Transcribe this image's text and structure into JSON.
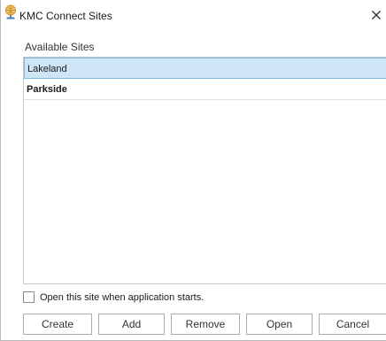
{
  "window": {
    "title": "KMC Connect Sites",
    "close_glyph": "✕"
  },
  "list": {
    "label": "Available Sites",
    "selected_index": 0,
    "items": [
      {
        "label": "Lakeland",
        "bold": false
      },
      {
        "label": "Parkside",
        "bold": true
      }
    ]
  },
  "startup_option": {
    "label": "Open this site when application starts.",
    "checked": false
  },
  "buttons": {
    "create": "Create",
    "add": "Add",
    "remove": "Remove",
    "open": "Open",
    "cancel": "Cancel"
  },
  "icons": {
    "app": "globe-connect-icon",
    "close": "close-icon"
  },
  "colors": {
    "selection_fill": "#cde5f5",
    "selection_border": "#7fb9e0",
    "icon_gold": "#d4962a",
    "icon_blue": "#3f7fbf"
  }
}
